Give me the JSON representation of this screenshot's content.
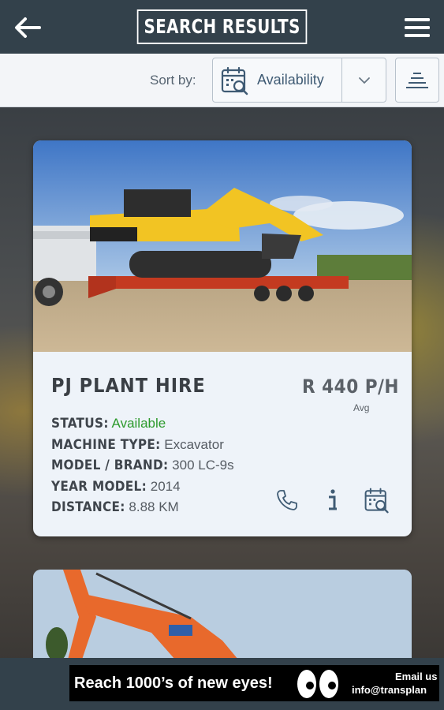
{
  "header": {
    "title": "SEARCH RESULTS",
    "back_icon": "arrow-left-icon",
    "menu_icon": "hamburger-menu-icon"
  },
  "sort": {
    "label": "Sort by:",
    "selected": "Availability",
    "icon": "calendar-search-icon",
    "order_icon": "sort-order-icon"
  },
  "results": [
    {
      "company": "PJ PLANT HIRE",
      "price": "R 440 P/H",
      "price_note": "Avg",
      "status_label": "STATUS:",
      "status_value": "Available",
      "machine_type_label": "MACHINE TYPE:",
      "machine_type_value": "Excavator",
      "model_label": "MODEL / BRAND:",
      "model_value": "300 LC-9s",
      "year_label": "YEAR MODEL:",
      "year_value": "2014",
      "distance_label": "DISTANCE:",
      "distance_value": "8.88 KM",
      "actions": [
        "phone-icon",
        "info-icon",
        "calendar-search-icon"
      ]
    }
  ],
  "ad": {
    "headline": "Reach 1000’s of new eyes!",
    "email_line1": "Email us",
    "email_line2": "info@transplan"
  },
  "colors": {
    "header_bg": "#33414b",
    "available": "#2c9a2c",
    "accent_blue": "#3f5b74"
  }
}
